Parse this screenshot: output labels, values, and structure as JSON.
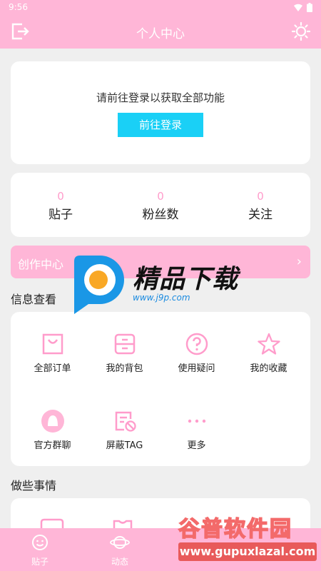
{
  "status": {
    "time": "9:56"
  },
  "header": {
    "title": "个人中心"
  },
  "login": {
    "prompt": "请前往登录以获取全部功能",
    "button": "前往登录"
  },
  "stats": [
    {
      "count": "0",
      "label": "贴子"
    },
    {
      "count": "0",
      "label": "粉丝数"
    },
    {
      "count": "0",
      "label": "关注"
    }
  ],
  "create_center": {
    "label": "创作中心",
    "chevron": "›"
  },
  "info_section": {
    "title": "信息查看",
    "items": [
      {
        "label": "全部订单",
        "icon": "shopping-bag-icon"
      },
      {
        "label": "我的背包",
        "icon": "backpack-icon"
      },
      {
        "label": "使用疑问",
        "icon": "question-icon"
      },
      {
        "label": "我的收藏",
        "icon": "star-icon"
      },
      {
        "label": "官方群聊",
        "icon": "chat-group-icon"
      },
      {
        "label": "屏蔽TAG",
        "icon": "block-tag-icon"
      },
      {
        "label": "更多",
        "icon": "more-icon"
      }
    ]
  },
  "do_section": {
    "title": "做些事情"
  },
  "bottom_nav": [
    {
      "label": "贴子",
      "icon": "smile-icon"
    },
    {
      "label": "动态",
      "icon": "planet-icon"
    }
  ],
  "watermarks": {
    "top_brand": "精品下载",
    "top_url": "www.j9p.com",
    "bottom_brand": "谷普软件园",
    "bottom_url": "www.gupuxlazal.com"
  },
  "colors": {
    "theme_pink": "#ffb6d7",
    "accent_cyan": "#1ad0f6",
    "count_pink": "#ff9ccb"
  }
}
